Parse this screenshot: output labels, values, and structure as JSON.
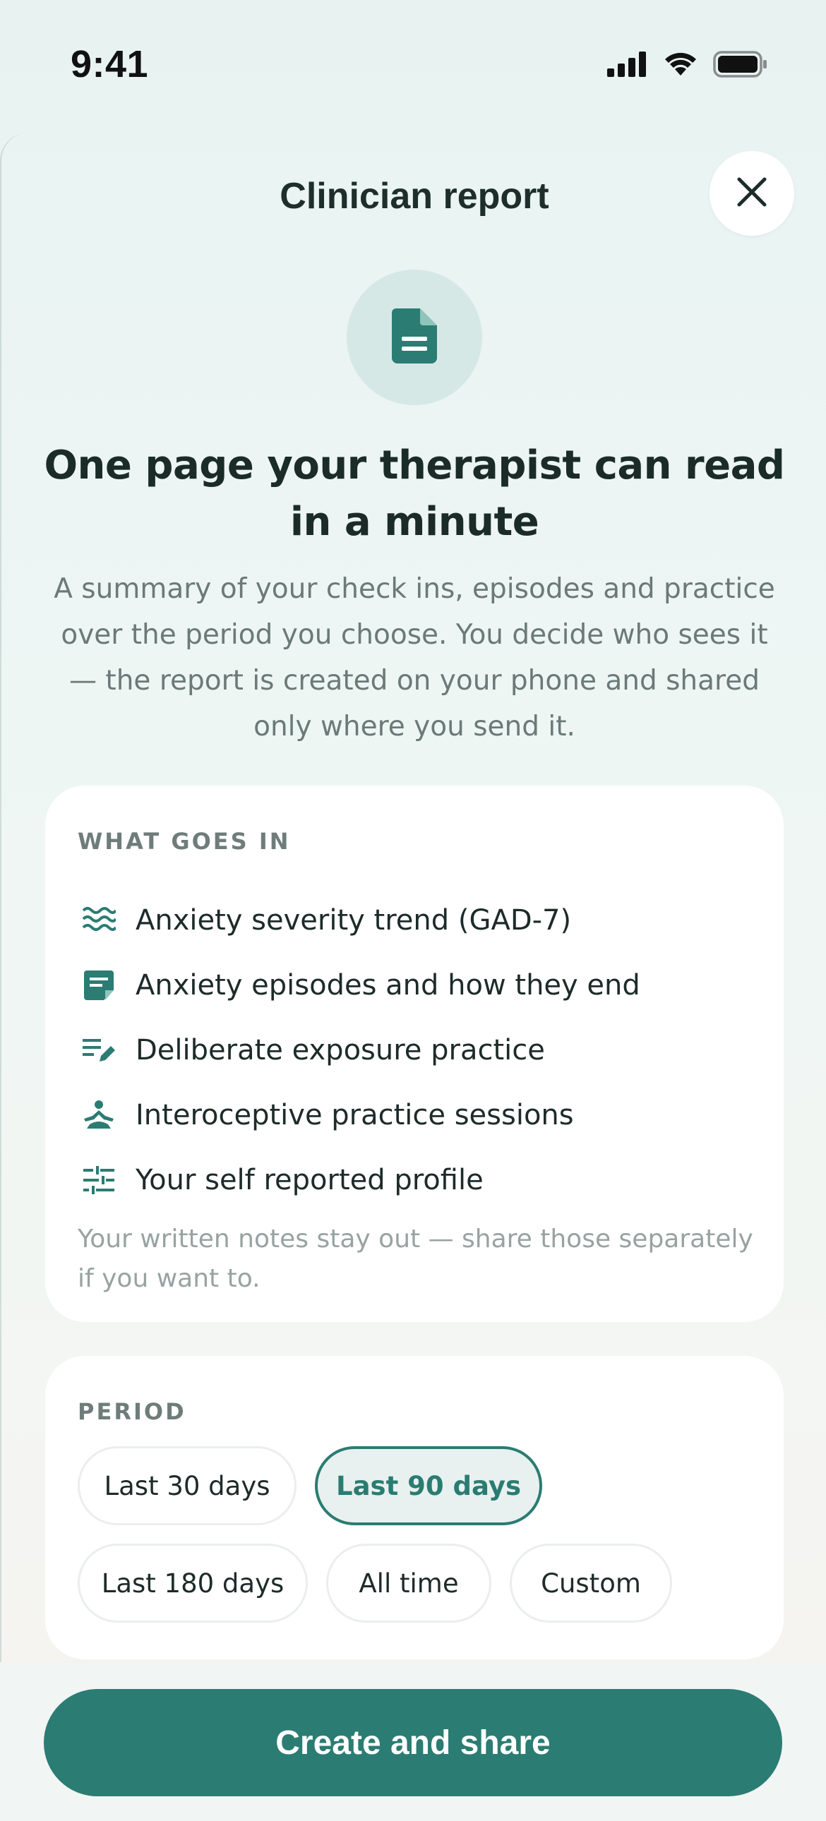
{
  "status_bar": {
    "time": "9:41",
    "icons": [
      "signal-icon",
      "wifi-icon",
      "battery-icon"
    ]
  },
  "header": {
    "title": "Clinician report",
    "close_icon": "close-icon"
  },
  "hero": {
    "icon": "document-icon",
    "headline": "One page your therapist can read in a minute",
    "description": "A summary of your check ins, episodes and practice over the period you choose. You decide who sees it — the report is created on your phone and shared only where you send it."
  },
  "what_goes_in": {
    "label": "WHAT GOES IN",
    "items": [
      {
        "icon": "waves-icon",
        "label": "Anxiety severity trend (GAD-7)"
      },
      {
        "icon": "note-icon",
        "label": "Anxiety episodes and how they end"
      },
      {
        "icon": "edit-list-icon",
        "label": "Deliberate exposure practice"
      },
      {
        "icon": "meditation-icon",
        "label": "Interoceptive practice sessions"
      },
      {
        "icon": "sliders-icon",
        "label": "Your self reported profile"
      }
    ],
    "note": "Your written notes stay out — share those separately if you want to."
  },
  "period": {
    "label": "PERIOD",
    "options": [
      {
        "label": "Last 30 days",
        "selected": false
      },
      {
        "label": "Last 90 days",
        "selected": true
      },
      {
        "label": "Last 180 days",
        "selected": false
      },
      {
        "label": "All time",
        "selected": false
      },
      {
        "label": "Custom",
        "selected": false
      }
    ]
  },
  "cta": {
    "label": "Create and share"
  },
  "colors": {
    "accent": "#2b7c72",
    "accent_soft": "#d6e8e5",
    "text_primary": "#1b2b28",
    "text_secondary": "#6b7a77",
    "card_bg": "#ffffff"
  }
}
